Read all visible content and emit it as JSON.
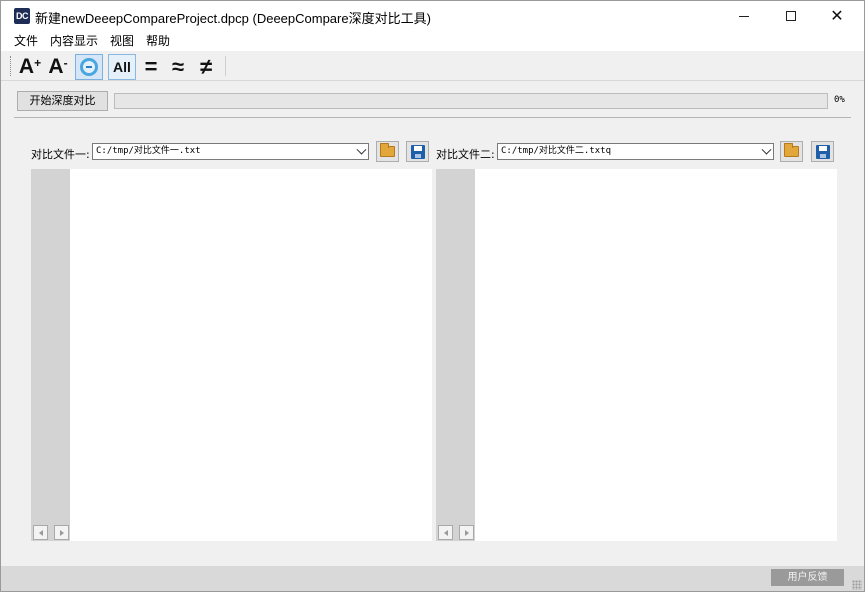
{
  "window": {
    "title": "新建newDeeepCompareProject.dpcp  (DeeepCompare深度对比工具)",
    "app_icon_text": "DC",
    "close_glyph": "✕"
  },
  "menu": {
    "items": [
      "文件",
      "内容显示",
      "视图",
      "帮助"
    ]
  },
  "toolbar": {
    "font_increase": "A",
    "font_increase_sup": "+",
    "font_decrease": "A",
    "font_decrease_sup": "-",
    "all": "All",
    "equal": "=",
    "approx": "≈",
    "not_equal": "≠"
  },
  "action": {
    "start_label": "开始深度对比",
    "progress_percent": 0,
    "progress_text": "0%"
  },
  "left_file": {
    "label": "对比文件一:",
    "path": "C:/tmp/对比文件一.txt"
  },
  "right_file": {
    "label": "对比文件二:",
    "path": "C:/tmp/对比文件二.txtq"
  },
  "status": {
    "feedback_label": "用户反馈"
  },
  "colors": {
    "accent": "#4aa6e0",
    "gutter": "#d3d3d3",
    "window_bg": "#f0f0f0"
  }
}
